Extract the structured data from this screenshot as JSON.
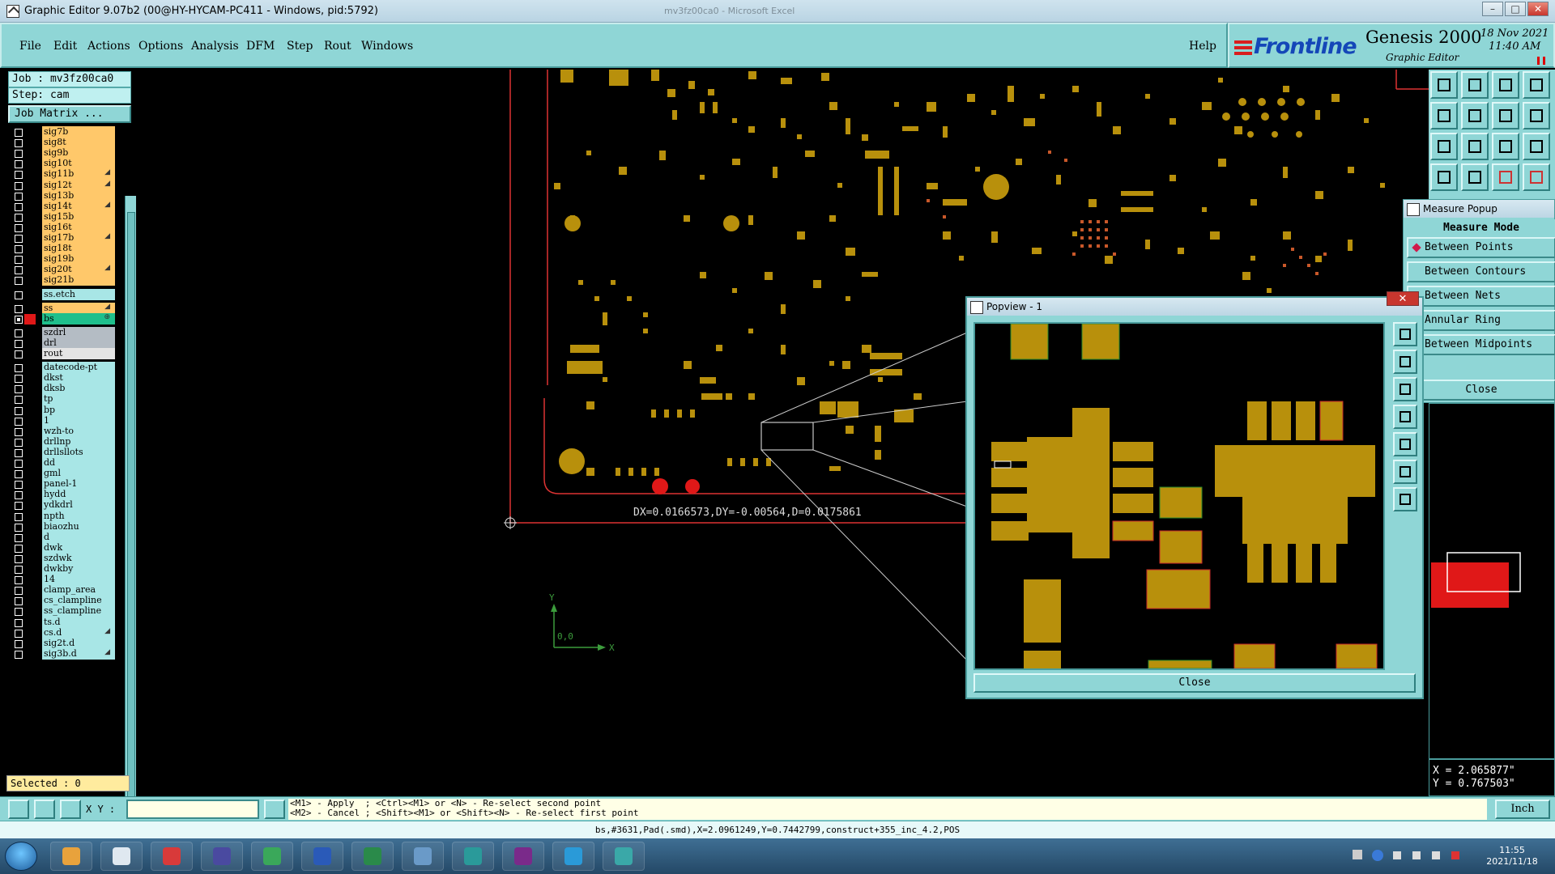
{
  "window": {
    "title": "Graphic Editor 9.07b2 (00@HY-HYCAM-PC411 - Windows, pid:5792)",
    "background_title": "mv3fz00ca0 - Microsoft Excel"
  },
  "menu": [
    "File",
    "Edit",
    "Actions",
    "Options",
    "Analysis",
    "DFM",
    "Step",
    "Rout",
    "Windows"
  ],
  "help": "Help",
  "brand": {
    "logo": "Frontline",
    "product": "Genesis 2000",
    "subtitle": "Graphic Editor",
    "date": "18 Nov 2021",
    "time": "11:40 AM"
  },
  "job": {
    "job_label": "Job : mv3fz00ca0",
    "step_label": "Step: cam",
    "matrix_button": "Job Matrix ..."
  },
  "layers": [
    {
      "name": "sig7b",
      "color": "#ffc86a",
      "mark": ""
    },
    {
      "name": "sig8t",
      "color": "#ffc86a",
      "mark": ""
    },
    {
      "name": "sig9b",
      "color": "#ffc86a",
      "mark": ""
    },
    {
      "name": "sig10t",
      "color": "#ffc86a",
      "mark": ""
    },
    {
      "name": "sig11b",
      "color": "#ffc86a",
      "mark": "◢"
    },
    {
      "name": "sig12t",
      "color": "#ffc86a",
      "mark": "◢"
    },
    {
      "name": "sig13b",
      "color": "#ffc86a",
      "mark": ""
    },
    {
      "name": "sig14t",
      "color": "#ffc86a",
      "mark": "◢"
    },
    {
      "name": "sig15b",
      "color": "#ffc86a",
      "mark": ""
    },
    {
      "name": "sig16t",
      "color": "#ffc86a",
      "mark": ""
    },
    {
      "name": "sig17b",
      "color": "#ffc86a",
      "mark": "◢"
    },
    {
      "name": "sig18t",
      "color": "#ffc86a",
      "mark": ""
    },
    {
      "name": "sig19b",
      "color": "#ffc86a",
      "mark": ""
    },
    {
      "name": "sig20t",
      "color": "#ffc86a",
      "mark": "◢"
    },
    {
      "name": "sig21b",
      "color": "#ffc86a",
      "mark": ""
    },
    {
      "name": "",
      "color": "",
      "mark": "",
      "gap": true
    },
    {
      "name": "ss.etch",
      "color": "#a8e6e6",
      "mark": ""
    },
    {
      "name": "",
      "color": "",
      "mark": "",
      "gap": true
    },
    {
      "name": "ss",
      "color": "#ffc86a",
      "mark": "◢"
    },
    {
      "name": "bs",
      "color": "#1fbf8c",
      "mark": "⊕",
      "active": true
    },
    {
      "name": "",
      "color": "",
      "mark": "",
      "gap": true
    },
    {
      "name": "szdrl",
      "color": "#b4bcc4",
      "mark": ""
    },
    {
      "name": "drl",
      "color": "#b4bcc4",
      "mark": ""
    },
    {
      "name": "rout",
      "color": "#e4e4e4",
      "mark": ""
    },
    {
      "name": "",
      "color": "",
      "mark": "",
      "gap": true
    },
    {
      "name": "datecode-pt",
      "color": "#a8e6e6",
      "mark": ""
    },
    {
      "name": "dkst",
      "color": "#a8e6e6",
      "mark": ""
    },
    {
      "name": "dksb",
      "color": "#a8e6e6",
      "mark": ""
    },
    {
      "name": "tp",
      "color": "#a8e6e6",
      "mark": ""
    },
    {
      "name": "bp",
      "color": "#a8e6e6",
      "mark": ""
    },
    {
      "name": "1",
      "color": "#a8e6e6",
      "mark": ""
    },
    {
      "name": "wzh-to",
      "color": "#a8e6e6",
      "mark": ""
    },
    {
      "name": "drllnp",
      "color": "#a8e6e6",
      "mark": ""
    },
    {
      "name": "drllsllots",
      "color": "#a8e6e6",
      "mark": ""
    },
    {
      "name": "dd",
      "color": "#a8e6e6",
      "mark": ""
    },
    {
      "name": "gml",
      "color": "#a8e6e6",
      "mark": ""
    },
    {
      "name": "panel-1",
      "color": "#a8e6e6",
      "mark": ""
    },
    {
      "name": "hydd",
      "color": "#a8e6e6",
      "mark": ""
    },
    {
      "name": "ydkdrl",
      "color": "#a8e6e6",
      "mark": ""
    },
    {
      "name": "npth",
      "color": "#a8e6e6",
      "mark": ""
    },
    {
      "name": "biaozhu",
      "color": "#a8e6e6",
      "mark": ""
    },
    {
      "name": "d",
      "color": "#a8e6e6",
      "mark": ""
    },
    {
      "name": "dwk",
      "color": "#a8e6e6",
      "mark": ""
    },
    {
      "name": "szdwk",
      "color": "#a8e6e6",
      "mark": ""
    },
    {
      "name": "dwkby",
      "color": "#a8e6e6",
      "mark": ""
    },
    {
      "name": "14",
      "color": "#a8e6e6",
      "mark": ""
    },
    {
      "name": "clamp_area",
      "color": "#a8e6e6",
      "mark": ""
    },
    {
      "name": "cs_clampline",
      "color": "#a8e6e6",
      "mark": ""
    },
    {
      "name": "ss_clampline",
      "color": "#a8e6e6",
      "mark": ""
    },
    {
      "name": "ts.d",
      "color": "#a8e6e6",
      "mark": ""
    },
    {
      "name": "cs.d",
      "color": "#a8e6e6",
      "mark": "◢"
    },
    {
      "name": "sig2t.d",
      "color": "#a8e6e6",
      "mark": ""
    },
    {
      "name": "sig3b.d",
      "color": "#a8e6e6",
      "mark": "◢"
    }
  ],
  "selected": "Selected : 0",
  "measure_text": "DX=0.0166573,DY=-0.00564,D=0.0175861",
  "axis": {
    "y": "Y",
    "x": "X",
    "origin": "0,0"
  },
  "measure_popup": {
    "title": "Measure Popup",
    "mode_title": "Measure Mode",
    "options": [
      "Between Points",
      "Between Contours",
      "Between Nets",
      "Annular Ring",
      "Between Midpoints"
    ],
    "close": "Close"
  },
  "popview": {
    "title": "Popview - 1",
    "close": "Close"
  },
  "coords": {
    "x": "X = 2.065877\"",
    "y": "Y = 0.767503\""
  },
  "cmd": {
    "xy_label": "X Y :",
    "xy_value": "",
    "hint_line1": "<M1> - Apply  ; <Ctrl><M1> or <N> - Re-select second point",
    "hint_line2": "<M2> - Cancel ; <Shift><M1> or <Shift><N> - Re-select first point",
    "unit": "Inch"
  },
  "status": "bs,#3631,Pad(.smd),X=2.0961249,Y=0.7442799,construct+355_inc_4.2,POS",
  "taskbar": {
    "apps": [
      "paint-app",
      "notepad-app",
      "g-app",
      "save-app",
      "p-app",
      "word-app",
      "excel-app",
      "image-app",
      "eye-app",
      "x-app",
      "feather-app",
      "genesis-app"
    ],
    "time": "11:55",
    "date": "2021/11/18"
  }
}
